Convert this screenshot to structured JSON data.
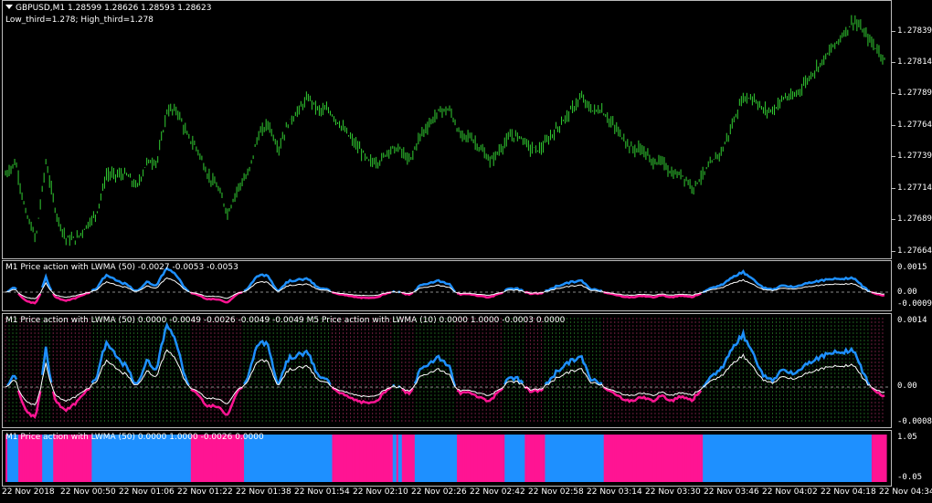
{
  "chart": {
    "header": "GBPUSD,M1  1.28599 1.28626 1.28593 1.28623",
    "subheader": "Low_third=1.278; High_third=1.278",
    "price_ticks": [
      "1.27839",
      "1.27814",
      "1.27789",
      "1.27764",
      "1.27739",
      "1.27714",
      "1.27689",
      "1.27664"
    ],
    "colors": {
      "bars": "#32cd32",
      "bull": "#1e90ff",
      "bear": "#ff1493",
      "background": "#000000",
      "grid": "#bcbcbc"
    }
  },
  "panes": {
    "ind1": {
      "title": "M1 Price action with LWMA (50) -0.0027 -0.0053 -0.0053",
      "ticks": [
        "0.0015",
        "0.00",
        "-0.0009"
      ]
    },
    "ind2": {
      "title": "M1 Price action with LWMA (50) 0.0000 -0.0049 -0.0026 -0.0049 -0.0049  M5 Price action with LWMA (10) 0.0000 1.0000 -0.0003 0.0000",
      "ticks": [
        "0.0014",
        "0.00",
        "-0.0008"
      ]
    },
    "ind3": {
      "title": "M1 Price action with LWMA (50) 0.0000 1.0000 -0.0026 0.0000",
      "ticks": [
        "1.05",
        "-0.05"
      ]
    }
  },
  "time_axis": [
    "22 Nov 2018",
    "22 Nov 00:50",
    "22 Nov 01:06",
    "22 Nov 01:22",
    "22 Nov 01:38",
    "22 Nov 01:54",
    "22 Nov 02:10",
    "22 Nov 02:26",
    "22 Nov 02:42",
    "22 Nov 02:58",
    "22 Nov 03:14",
    "22 Nov 03:30",
    "22 Nov 03:46",
    "22 Nov 04:02",
    "22 Nov 04:18",
    "22 Nov 04:34"
  ],
  "price_path": [
    1.2772,
    1.2773,
    1.2769,
    1.2767,
    1.2773,
    1.2769,
    1.2767,
    1.2767,
    1.2768,
    1.2769,
    1.2772,
    1.2772,
    1.2772,
    1.2771,
    1.2773,
    1.2773,
    1.2777,
    1.2777,
    1.2775,
    1.2774,
    1.2772,
    1.2771,
    1.2769,
    1.2771,
    1.2772,
    1.2775,
    1.2776,
    1.2774,
    1.2776,
    1.2777,
    1.2778,
    1.2777,
    1.2777,
    1.2776,
    1.2775,
    1.2774,
    1.2773,
    1.2773,
    1.2774,
    1.2774,
    1.2773,
    1.2775,
    1.2776,
    1.2777,
    1.2777,
    1.2775,
    1.2775,
    1.2774,
    1.2773,
    1.2774,
    1.2775,
    1.2775,
    1.2774,
    1.2774,
    1.2775,
    1.2776,
    1.2777,
    1.2778,
    1.2777,
    1.2777,
    1.2776,
    1.2775,
    1.2774,
    1.2774,
    1.2773,
    1.2773,
    1.2772,
    1.2772,
    1.2771,
    1.2772,
    1.2773,
    1.2774,
    1.2776,
    1.2778,
    1.2778,
    1.2777,
    1.2777,
    1.2778,
    1.2778,
    1.2779,
    1.278,
    1.2781,
    1.2782,
    1.2783,
    1.2784,
    1.2783,
    1.2782,
    1.2781
  ]
}
